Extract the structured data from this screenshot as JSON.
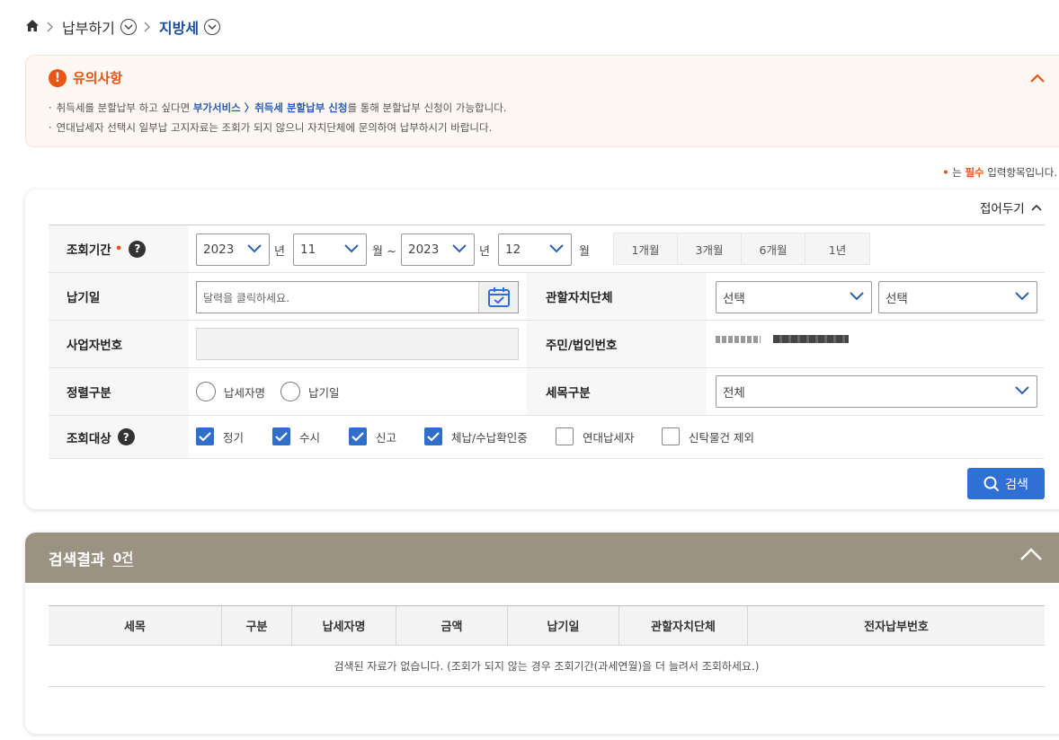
{
  "breadcrumb": {
    "items": [
      "납부하기",
      "지방세"
    ]
  },
  "notice": {
    "icon": "!",
    "title": "유의사항",
    "line1_pre": "취득세를 분할납부 하고 싶다면 ",
    "line1_link": "부가서비스 〉취득세 분할납부 신청",
    "line1_post": "를 통해 분할납부 신청이 가능합니다.",
    "line2": "연대납세자 선택시 일부납 고지자료는 조회가 되지 않으니 자치단체에 문의하여 납부하시기 바랍니다."
  },
  "required_note": {
    "dot": "•",
    "pre": " 는 ",
    "req": "필수",
    "post": " 입력항목입니다."
  },
  "search": {
    "fold_label": "접어두기",
    "period": {
      "label": "조회기간",
      "required_mark": "•",
      "help": "?",
      "start_year": "2023",
      "start_month": "11",
      "end_year": "2023",
      "end_month": "12",
      "unit_year": "년",
      "unit_month_tilde": "월 ~",
      "unit_month": "월",
      "quick": [
        "1개월",
        "3개월",
        "6개월",
        "1년"
      ]
    },
    "due_date": {
      "label": "납기일",
      "placeholder": "달력을 클릭하세요."
    },
    "jurisdiction": {
      "label": "관할자치단체",
      "select1": "선택",
      "select2": "선택"
    },
    "business_no": {
      "label": "사업자번호",
      "value": ""
    },
    "resident_no": {
      "label": "주민/법인번호"
    },
    "sort": {
      "label": "정렬구분",
      "options": [
        "납세자명",
        "납기일"
      ]
    },
    "tax_item": {
      "label": "세목구분",
      "value": "전체"
    },
    "target": {
      "label": "조회대상",
      "help": "?",
      "options": [
        {
          "label": "정기",
          "checked": true
        },
        {
          "label": "수시",
          "checked": true
        },
        {
          "label": "신고",
          "checked": true
        },
        {
          "label": "체납/수납확인중",
          "checked": true
        },
        {
          "label": "연대납세자",
          "checked": false
        },
        {
          "label": "신탁물건 제외",
          "checked": false
        }
      ]
    },
    "search_button": "검색"
  },
  "results": {
    "title": "검색결과",
    "count": "0건",
    "columns": [
      "세목",
      "구분",
      "납세자명",
      "금액",
      "납기일",
      "관할자치단체",
      "전자납부번호"
    ],
    "empty_message": "검색된 자료가 없습니다. (조회가 되지 않는 경우 조회기간(과세연월)을 더 늘려서 조회하세요.)"
  },
  "colors": {
    "accent_orange": "#ea5414",
    "primary_blue": "#2f70d6",
    "results_header": "#9c9281"
  }
}
